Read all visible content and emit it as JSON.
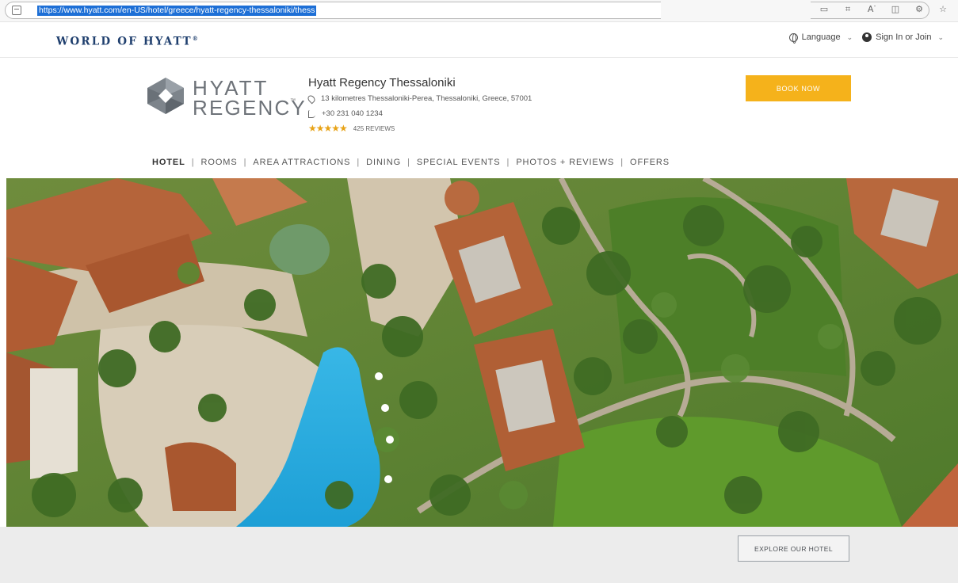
{
  "browser": {
    "url": "https://www.hyatt.com/en-US/hotel/greece/hyatt-regency-thessaloniki/thess",
    "toolbar_icons": [
      "reader-view-icon",
      "translate-icon",
      "read-aloud-icon",
      "split-screen-icon",
      "extension-icon",
      "favorites-icon"
    ]
  },
  "utility": {
    "brand": "WORLD OF HYATT",
    "brand_mark": "®",
    "language": "Language",
    "signin": "Sign In or Join"
  },
  "hotel": {
    "logo_line1": "HYATT",
    "logo_line2": "REGENCY",
    "logo_tm": "™",
    "name": "Hyatt Regency Thessaloniki",
    "address": "13 kilometres Thessaloniki-Perea, Thessaloniki, Greece, 57001",
    "phone": "+30 231 040 1234",
    "stars": "★★★★★",
    "reviews": "425 REVIEWS",
    "book_now": "BOOK NOW"
  },
  "nav": {
    "items": [
      {
        "label": "HOTEL",
        "active": true
      },
      {
        "label": "ROOMS",
        "active": false
      },
      {
        "label": "AREA ATTRACTIONS",
        "active": false
      },
      {
        "label": "DINING",
        "active": false
      },
      {
        "label": "SPECIAL EVENTS",
        "active": false
      },
      {
        "label": "PHOTOS + REVIEWS",
        "active": false
      },
      {
        "label": "OFFERS",
        "active": false
      }
    ],
    "separator": "|"
  },
  "bottom": {
    "explore": "EXPLORE OUR HOTEL"
  },
  "colors": {
    "brand_navy": "#1f3f6e",
    "book_yellow": "#f5b21b",
    "star_gold": "#e8a317"
  }
}
